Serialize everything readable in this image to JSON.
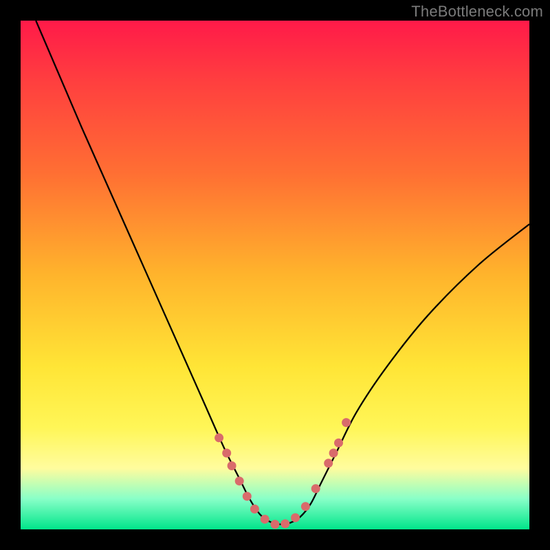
{
  "watermark": "TheBottleneck.com",
  "chart_data": {
    "type": "line",
    "title": "",
    "xlabel": "",
    "ylabel": "",
    "xlim": [
      0,
      100
    ],
    "ylim": [
      0,
      100
    ],
    "series": [
      {
        "name": "bottleneck-curve",
        "x": [
          3,
          6,
          9,
          12,
          16,
          20,
          24,
          28,
          32,
          36,
          40,
          43,
          45,
          47,
          49,
          51,
          53,
          55,
          57,
          59,
          62,
          66,
          72,
          80,
          90,
          100
        ],
        "y": [
          100,
          93,
          86,
          79,
          70,
          61,
          52,
          43,
          34,
          25,
          16,
          10,
          6,
          3,
          1.5,
          1,
          1.3,
          2.5,
          5,
          9,
          15,
          23,
          32,
          42,
          52,
          60
        ]
      }
    ],
    "markers": {
      "name": "highlight-dots",
      "color": "#d96b6b",
      "x": [
        39,
        40.5,
        41.5,
        43,
        44.5,
        46,
        48,
        50,
        52,
        54,
        56,
        58,
        60.5,
        61.5,
        62.5,
        64
      ],
      "y": [
        18,
        15,
        12.5,
        9.5,
        6.5,
        4,
        2,
        1,
        1.1,
        2.3,
        4.5,
        8,
        13,
        15,
        17,
        21
      ]
    }
  }
}
